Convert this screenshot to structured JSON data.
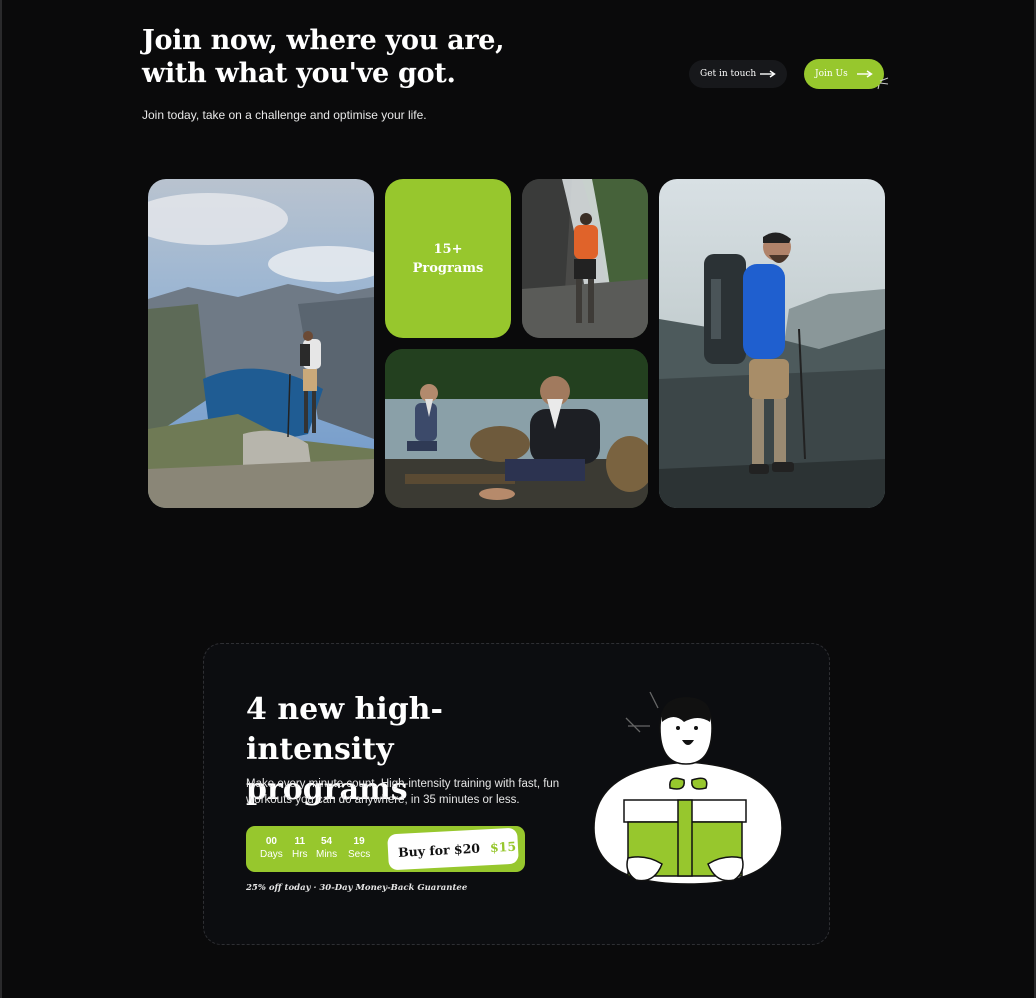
{
  "hero": {
    "headline_line1": "Join now, where you are,",
    "headline_line2": "with what you've got.",
    "subline": "Join today, take on a challenge and optimise your life."
  },
  "nav": {
    "contact_label": "Get in touch",
    "join_label": "Join Us"
  },
  "gallery": {
    "programs_count": "15+",
    "programs_label": "Programs",
    "photos": [
      "hiker-fjord-photo",
      "hiker-waterfall-photo",
      "elders-river-photo",
      "hiker-mountain-photo"
    ]
  },
  "promo": {
    "title_line1": "4 new high-intensity",
    "title_line2": "programs",
    "description": "Make every minute count. High-intensity training with fast, fun workouts you can do anywhere, in 35 minutes or less.",
    "countdown": [
      {
        "value": "00",
        "unit": "Days"
      },
      {
        "value": "11",
        "unit": "Hrs"
      },
      {
        "value": "54",
        "unit": "Mins"
      },
      {
        "value": "19",
        "unit": "Secs"
      }
    ],
    "buy_label": "Buy for $20",
    "sale_price": "$15",
    "fineprint": "25% off today · 30-Day Money-Back Guarantee"
  },
  "colors": {
    "background": "#0a0a0b",
    "accent": "#97c72d",
    "card": "#0c0d10"
  },
  "icons": {
    "arrow": "arrow-right-icon",
    "spark": "click-sparkle-icon",
    "gift": "gift-illustration"
  }
}
